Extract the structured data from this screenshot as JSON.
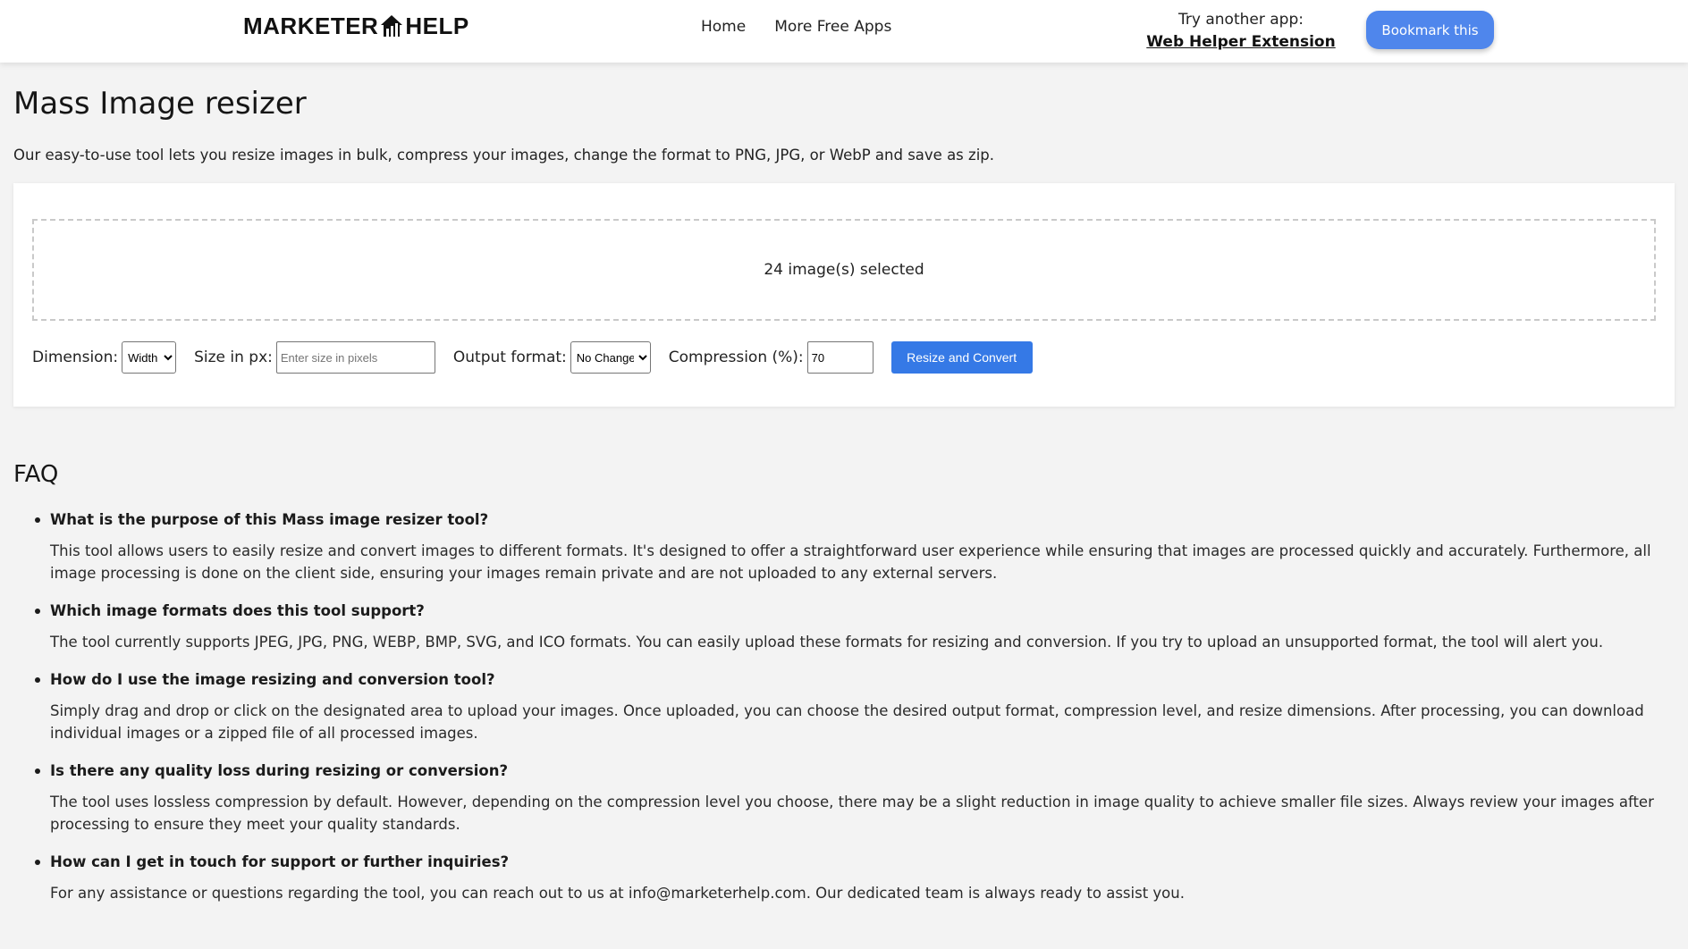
{
  "header": {
    "logo_left": "MARKETER",
    "logo_right": "HELP",
    "nav": [
      "Home",
      "More Free Apps"
    ],
    "try_label": "Try another app:",
    "try_link": "Web Helper Extension",
    "bookmark_label": "Bookmark this",
    "colors": {
      "bookmark_bg": "#4f86ec"
    }
  },
  "main": {
    "title": "Mass Image resizer",
    "intro": "Our easy-to-use tool lets you resize images in bulk, compress your images, change the format to PNG, JPG, or WebP and save as zip."
  },
  "tool": {
    "dropzone_text": "24 image(s) selected",
    "dimension_label": "Dimension:",
    "dimension_value": "Width",
    "size_label": "Size in px:",
    "size_placeholder": "Enter size in pixels",
    "format_label": "Output format:",
    "format_value": "No Change",
    "compression_label": "Compression (%):",
    "compression_value": "70",
    "submit_label": "Resize and Convert",
    "colors": {
      "submit_bg": "#3579e6"
    }
  },
  "faq": {
    "title": "FAQ",
    "items": [
      {
        "q": "What is the purpose of this Mass image resizer tool?",
        "a": "This tool allows users to easily resize and convert images to different formats. It's designed to offer a straightforward user experience while ensuring that images are processed quickly and accurately. Furthermore, all image processing is done on the client side, ensuring your images remain private and are not uploaded to any external servers."
      },
      {
        "q": "Which image formats does this tool support?",
        "a": "The tool currently supports JPEG, JPG, PNG, WEBP, BMP, SVG, and ICO formats. You can easily upload these formats for resizing and conversion. If you try to upload an unsupported format, the tool will alert you."
      },
      {
        "q": "How do I use the image resizing and conversion tool?",
        "a": "Simply drag and drop or click on the designated area to upload your images. Once uploaded, you can choose the desired output format, compression level, and resize dimensions. After processing, you can download individual images or a zipped file of all processed images."
      },
      {
        "q": "Is there any quality loss during resizing or conversion?",
        "a": "The tool uses lossless compression by default. However, depending on the compression level you choose, there may be a slight reduction in image quality to achieve smaller file sizes. Always review your images after processing to ensure they meet your quality standards."
      },
      {
        "q": "How can I get in touch for support or further inquiries?",
        "a": "For any assistance or questions regarding the tool, you can reach out to us at info@marketerhelp.com. Our dedicated team is always ready to assist you."
      }
    ]
  }
}
